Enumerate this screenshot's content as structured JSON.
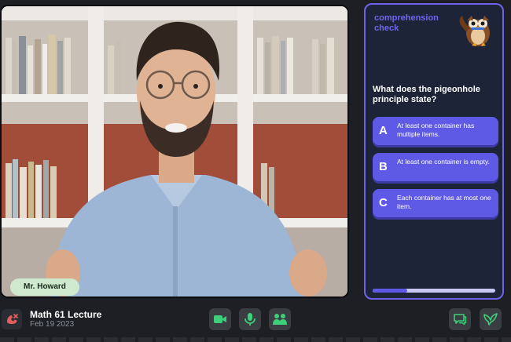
{
  "video": {
    "speaker_name": "Mr. Howard"
  },
  "quiz": {
    "title": "comprehension check",
    "mascot_icon": "owl-mascot-icon",
    "question": "What does the pigeonhole principle state?",
    "options": [
      {
        "letter": "A",
        "text": "At least one container has multiple items."
      },
      {
        "letter": "B",
        "text": "At least one container is empty."
      },
      {
        "letter": "C",
        "text": "Each container has at most one item."
      }
    ],
    "progress_fraction": 0.28,
    "colors": {
      "accent": "#5f5ae6",
      "card_bg": "#1e2438",
      "border": "#6c63ea"
    }
  },
  "meeting": {
    "title": "Math 61 Lecture",
    "date": "Feb 19 2023"
  },
  "controls": {
    "leave_icon": "phone-hangup-icon",
    "buttons": [
      {
        "name": "camera",
        "icon": "video-camera-icon"
      },
      {
        "name": "microphone",
        "icon": "microphone-icon"
      },
      {
        "name": "participants",
        "icon": "people-icon"
      }
    ],
    "right_buttons": [
      {
        "name": "chat",
        "icon": "chat-bubble-icon"
      },
      {
        "name": "quiz-bird",
        "icon": "bird-icon"
      }
    ],
    "accent_green": "#3ecf7a"
  }
}
